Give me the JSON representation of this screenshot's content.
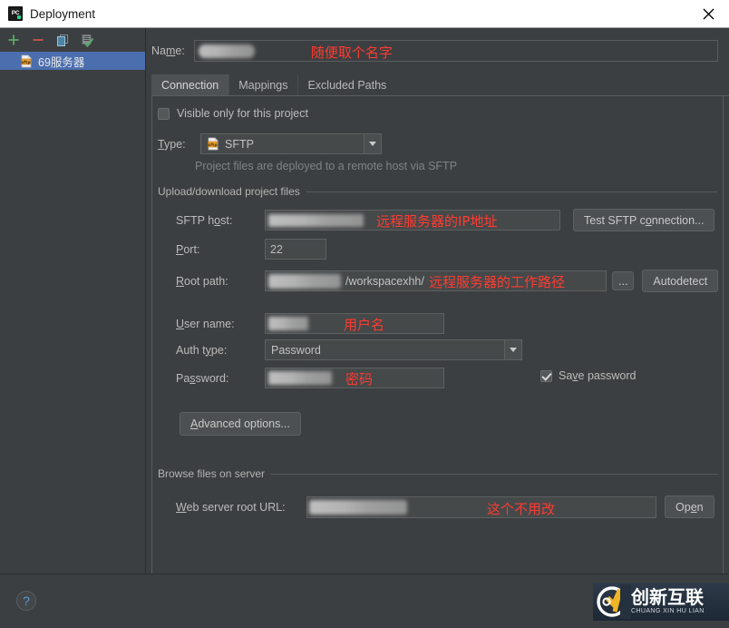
{
  "window": {
    "title": "Deployment",
    "app_icon": "pycharm-icon",
    "close_icon": "close-icon"
  },
  "sidebar": {
    "toolbar": [
      {
        "name": "add-button",
        "icon": "plus-icon",
        "color": "#59a869"
      },
      {
        "name": "remove-button",
        "icon": "minus-icon",
        "color": "#c75450"
      },
      {
        "name": "copy-button",
        "icon": "copy-icon",
        "color": "#6ba4bb"
      },
      {
        "name": "use-as-default-button",
        "icon": "apply-check-icon",
        "color": "#59a869"
      }
    ],
    "items": [
      {
        "label": "69服务器",
        "icon": "sftp-icon",
        "selected": true
      }
    ]
  },
  "form": {
    "name_label": "Name:",
    "name_value": "",
    "name_annotation": "随便取个名字",
    "tabs": [
      {
        "label": "Connection",
        "active": true
      },
      {
        "label": "Mappings",
        "active": false
      },
      {
        "label": "Excluded Paths",
        "active": false
      }
    ],
    "visible_only_label": "Visible only for this project",
    "visible_only_checked": false,
    "type_label": "Type:",
    "type_value": "SFTP",
    "type_icon": "sftp-icon",
    "type_hint": "Project files are deployed to a remote host via SFTP",
    "upload_group_label": "Upload/download project files",
    "sftp_host_label": "SFTP host:",
    "sftp_host_value": "",
    "sftp_host_annotation": "远程服务器的IP地址",
    "test_connection_label": "Test SFTP connection...",
    "port_label": "Port:",
    "port_value": "22",
    "root_path_label": "Root path:",
    "root_path_value": "/workspacexhh/",
    "root_path_annotation": "远程服务器的工作路径",
    "browse_button_label": "...",
    "autodetect_label": "Autodetect",
    "user_name_label": "User name:",
    "user_name_value": "",
    "user_name_annotation": "用户名",
    "auth_type_label": "Auth type:",
    "auth_type_value": "Password",
    "password_label": "Password:",
    "password_value": "",
    "password_annotation": "密码",
    "save_password_label": "Save password",
    "save_password_checked": true,
    "advanced_options_label": "Advanced options...",
    "browse_group_label": "Browse files on server",
    "web_root_label": "Web server root URL:",
    "web_root_value": "",
    "web_root_annotation": "这个不用改",
    "open_label": "Open"
  },
  "footer": {
    "help_icon": "question-mark-icon",
    "help_label": "?",
    "watermark_cn": "创新互联",
    "watermark_en": "CHUANG XIN HU LIAN"
  },
  "colors": {
    "background": "#3c3f41",
    "selection": "#4b6eaf",
    "annotation": "#ff3b30",
    "accent_green": "#59a869",
    "accent_red": "#c75450"
  }
}
